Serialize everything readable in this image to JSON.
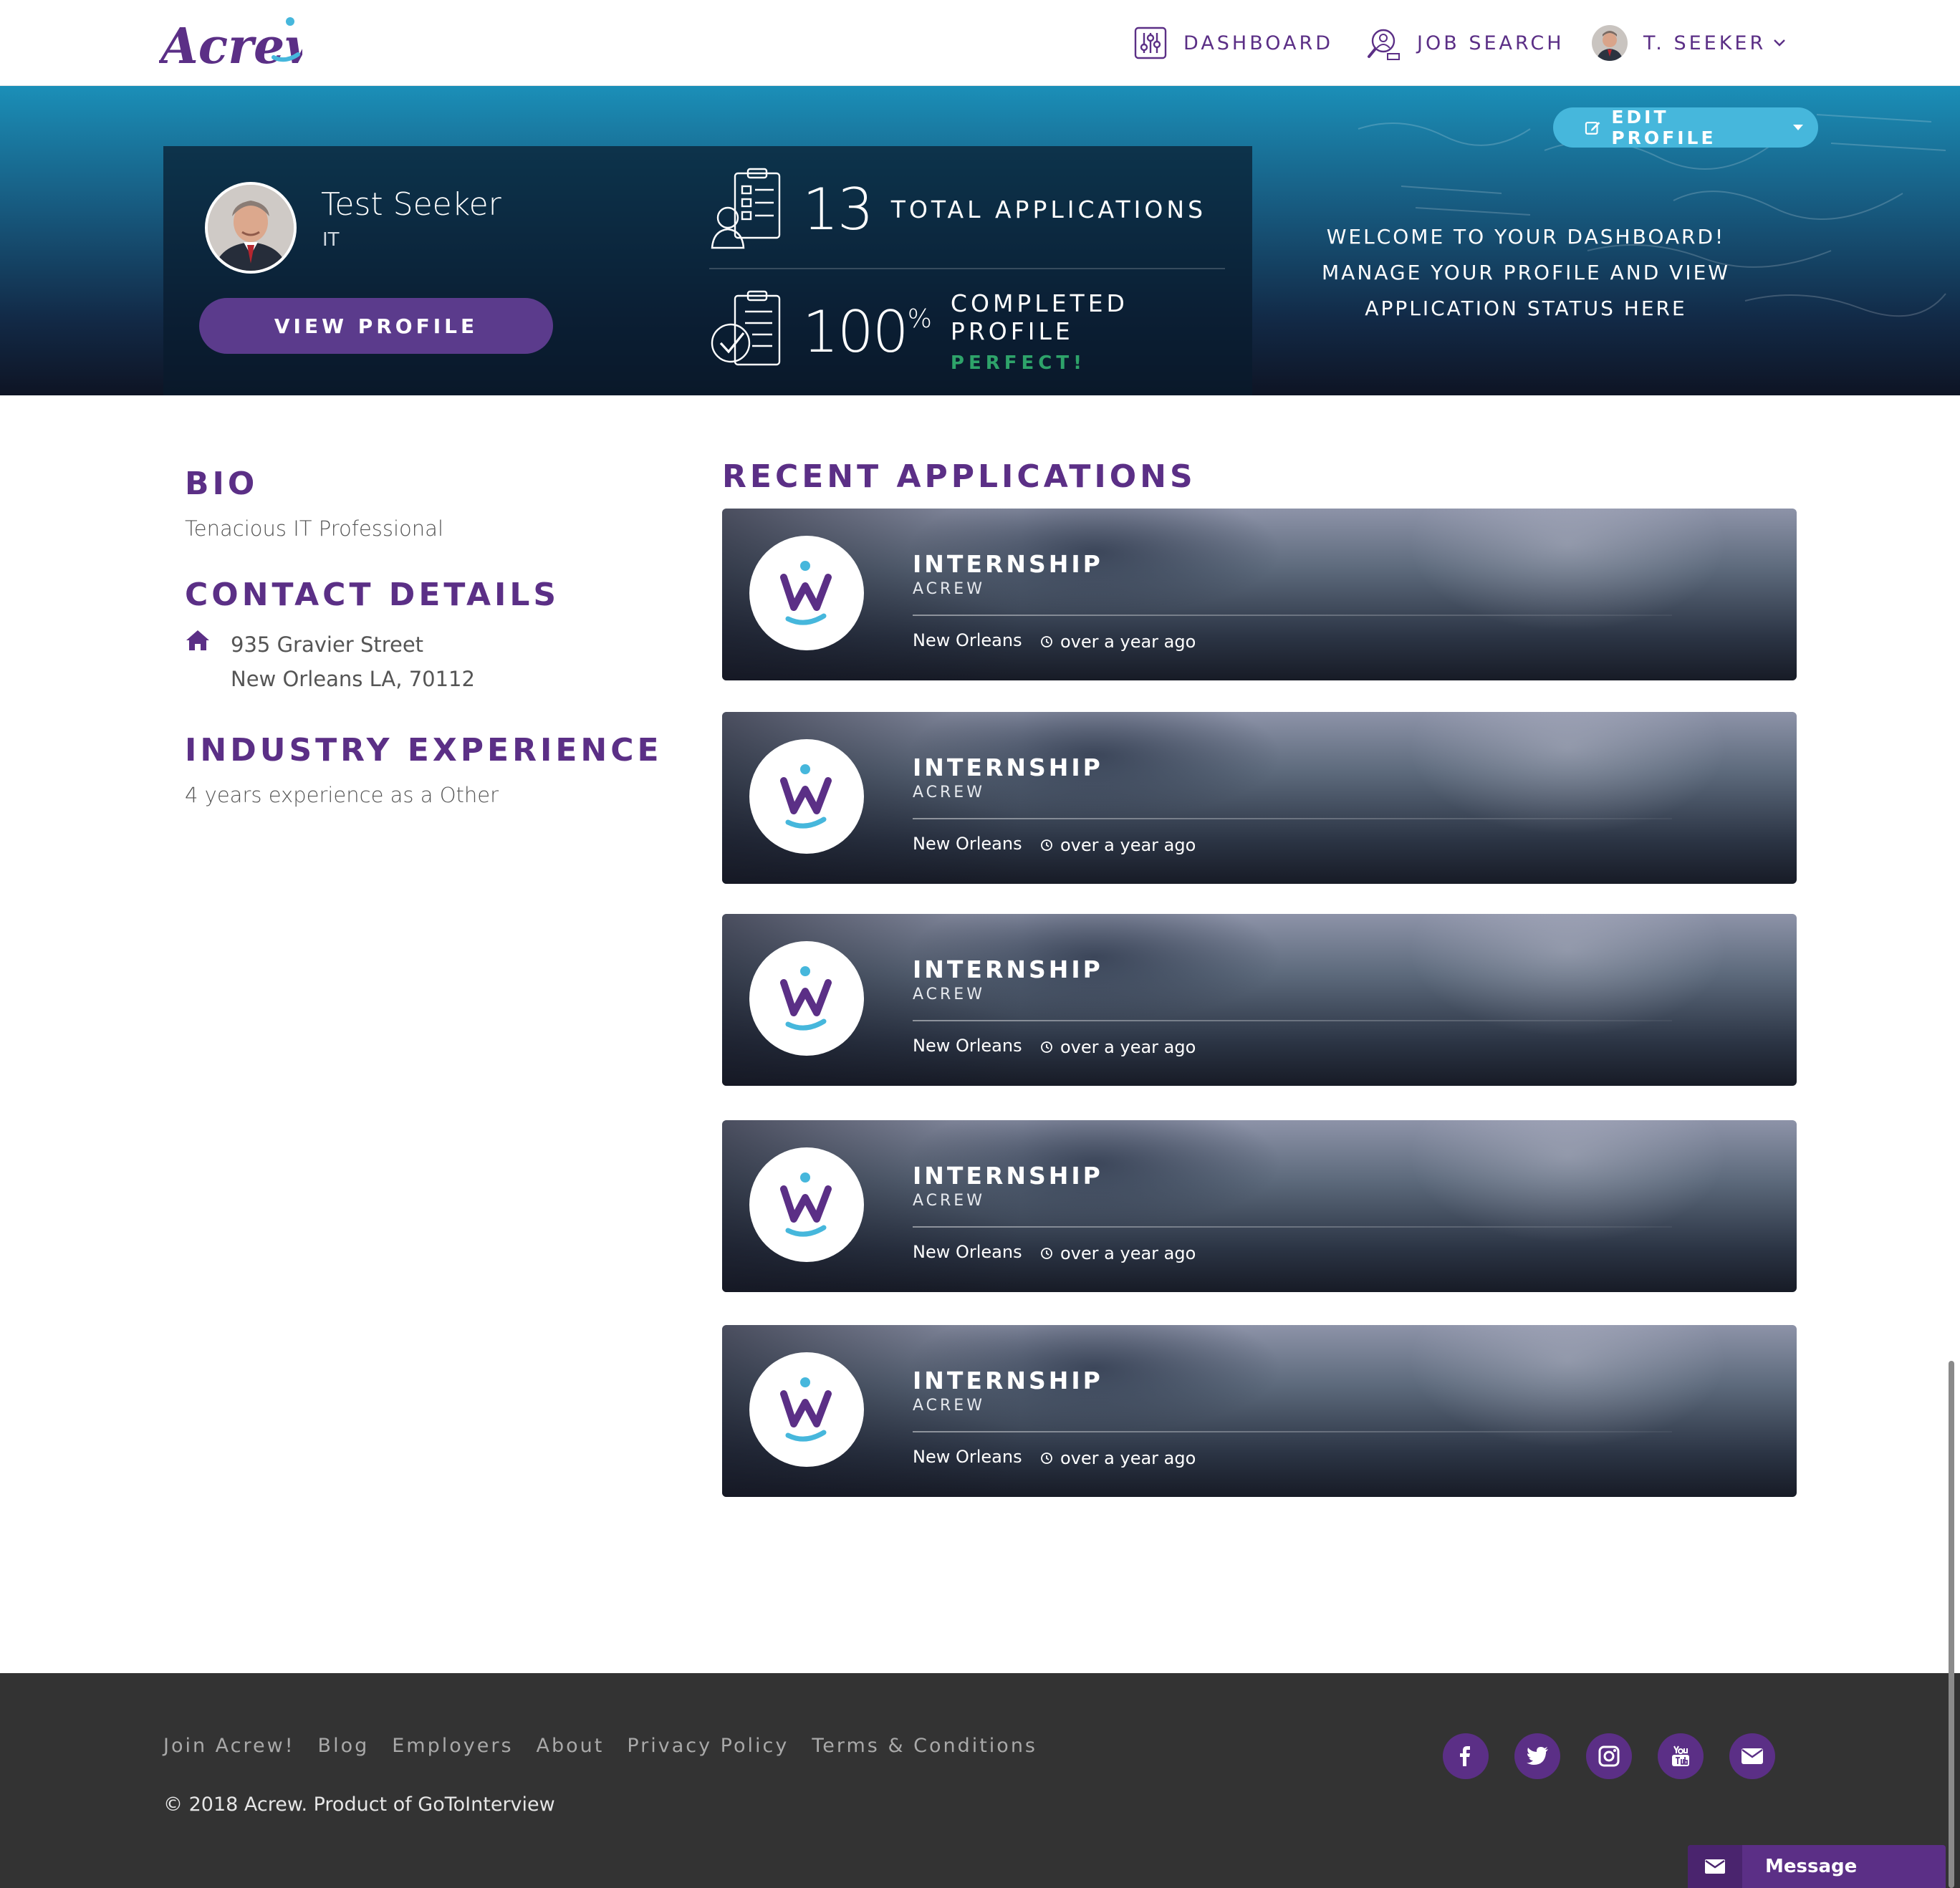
{
  "brand": {
    "logo_text": "Acrew",
    "color_primary": "#5b2f86",
    "color_accent": "#46b7dc"
  },
  "nav": {
    "dashboard": {
      "label": "DASHBOARD",
      "icon": "sliders-icon"
    },
    "job_search": {
      "label": "JOB SEARCH",
      "icon": "search-person-icon"
    },
    "user": {
      "label": "T. SEEKER",
      "icon": "chevron-down-icon"
    }
  },
  "hero": {
    "edit_profile_label": "EDIT PROFILE",
    "profile": {
      "name": "Test Seeker",
      "role": "IT",
      "view_profile_label": "VIEW PROFILE"
    },
    "stats": {
      "applications": {
        "value": "13",
        "label": "TOTAL APPLICATIONS"
      },
      "completion": {
        "value": "100",
        "unit": "%",
        "label": "COMPLETED PROFILE",
        "sub": "PERFECT!"
      }
    },
    "welcome": [
      "WELCOME TO YOUR DASHBOARD!",
      "MANAGE YOUR PROFILE AND VIEW",
      "APPLICATION STATUS HERE"
    ]
  },
  "bio": {
    "title": "BIO",
    "text": "Tenacious IT Professional"
  },
  "contact": {
    "title": "CONTACT DETAILS",
    "address_line1": "935 Gravier Street",
    "address_line2": "New Orleans LA, 70112"
  },
  "industry": {
    "title": "INDUSTRY EXPERIENCE",
    "text": "4 years experience as a Other"
  },
  "recent_applications": {
    "title": "RECENT APPLICATIONS",
    "items": [
      {
        "title": "INTERNSHIP",
        "company": "ACREW",
        "location": "New Orleans",
        "time": "over a year ago"
      },
      {
        "title": "INTERNSHIP",
        "company": "ACREW",
        "location": "New Orleans",
        "time": "over a year ago"
      },
      {
        "title": "INTERNSHIP",
        "company": "ACREW",
        "location": "New Orleans",
        "time": "over a year ago"
      },
      {
        "title": "INTERNSHIP",
        "company": "ACREW",
        "location": "New Orleans",
        "time": "over a year ago"
      },
      {
        "title": "INTERNSHIP",
        "company": "ACREW",
        "location": "New Orleans",
        "time": "over a year ago"
      }
    ]
  },
  "footer": {
    "links": [
      "Join Acrew!",
      "Blog",
      "Employers",
      "About",
      "Privacy Policy",
      "Terms & Conditions"
    ],
    "copyright": "© 2018 Acrew. Product of GoToInterview",
    "socials": [
      "facebook-icon",
      "twitter-icon",
      "instagram-icon",
      "youtube-icon",
      "email-icon"
    ]
  },
  "message_widget": {
    "label": "Message"
  }
}
